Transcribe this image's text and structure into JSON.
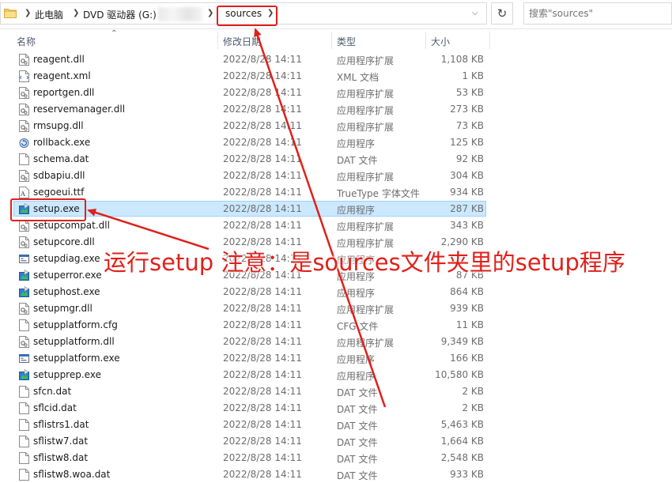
{
  "address_bar": {
    "crumbs": [
      "此电脑",
      "DVD 驱动器 (G:)",
      "sources"
    ],
    "refresh_icon": "refresh-icon",
    "dropdown_icon": "chevron-down-icon"
  },
  "search": {
    "placeholder": "搜索\"sources\""
  },
  "columns": {
    "name": "名称",
    "date": "修改日期",
    "type": "类型",
    "size": "大小"
  },
  "files": [
    {
      "name": "reagent.dll",
      "date": "2022/8/28 14:11",
      "type": "应用程序扩展",
      "size": "1,108 KB",
      "icon": "dll"
    },
    {
      "name": "reagent.xml",
      "date": "2022/8/28 14:11",
      "type": "XML 文档",
      "size": "1 KB",
      "icon": "xml"
    },
    {
      "name": "reportgen.dll",
      "date": "2022/8/28 14:11",
      "type": "应用程序扩展",
      "size": "53 KB",
      "icon": "dll"
    },
    {
      "name": "reservemanager.dll",
      "date": "2022/8/28 14:11",
      "type": "应用程序扩展",
      "size": "273 KB",
      "icon": "dll"
    },
    {
      "name": "rmsupg.dll",
      "date": "2022/8/28 14:11",
      "type": "应用程序扩展",
      "size": "73 KB",
      "icon": "dll"
    },
    {
      "name": "rollback.exe",
      "date": "2022/8/28 14:11",
      "type": "应用程序",
      "size": "125 KB",
      "icon": "exe-rollback"
    },
    {
      "name": "schema.dat",
      "date": "2022/8/28 14:11",
      "type": "DAT 文件",
      "size": "92 KB",
      "icon": "file"
    },
    {
      "name": "sdbapiu.dll",
      "date": "2022/8/28 14:11",
      "type": "应用程序扩展",
      "size": "304 KB",
      "icon": "dll"
    },
    {
      "name": "segoeui.ttf",
      "date": "2022/8/28 14:11",
      "type": "TrueType 字体文件",
      "size": "934 KB",
      "icon": "font"
    },
    {
      "name": "setup.exe",
      "date": "2022/8/28 14:11",
      "type": "应用程序",
      "size": "287 KB",
      "icon": "exe-setup",
      "selected": true
    },
    {
      "name": "setupcompat.dll",
      "date": "2022/8/28 14:11",
      "type": "应用程序扩展",
      "size": "343 KB",
      "icon": "dll"
    },
    {
      "name": "setupcore.dll",
      "date": "2022/8/28 14:11",
      "type": "应用程序扩展",
      "size": "2,290 KB",
      "icon": "dll"
    },
    {
      "name": "setupdiag.exe",
      "date": "2022/8/28 14:11",
      "type": "应用程序",
      "size": "",
      "icon": "exe-window"
    },
    {
      "name": "setuperror.exe",
      "date": "2022/8/28 14:11",
      "type": "应用程序",
      "size": "87 KB",
      "icon": "exe-setup"
    },
    {
      "name": "setuphost.exe",
      "date": "2022/8/28 14:11",
      "type": "应用程序",
      "size": "864 KB",
      "icon": "exe-setup"
    },
    {
      "name": "setupmgr.dll",
      "date": "2022/8/28 14:11",
      "type": "应用程序扩展",
      "size": "939 KB",
      "icon": "dll"
    },
    {
      "name": "setupplatform.cfg",
      "date": "2022/8/28 14:11",
      "type": "CFG 文件",
      "size": "11 KB",
      "icon": "file"
    },
    {
      "name": "setupplatform.dll",
      "date": "2022/8/28 14:11",
      "type": "应用程序扩展",
      "size": "9,349 KB",
      "icon": "dll"
    },
    {
      "name": "setupplatform.exe",
      "date": "2022/8/28 14:11",
      "type": "应用程序",
      "size": "166 KB",
      "icon": "exe-window"
    },
    {
      "name": "setupprep.exe",
      "date": "2022/8/28 14:11",
      "type": "应用程序",
      "size": "10,580 KB",
      "icon": "exe-setup"
    },
    {
      "name": "sfcn.dat",
      "date": "2022/8/28 14:11",
      "type": "DAT 文件",
      "size": "2 KB",
      "icon": "file"
    },
    {
      "name": "sflcid.dat",
      "date": "2022/8/28 14:11",
      "type": "DAT 文件",
      "size": "2 KB",
      "icon": "file"
    },
    {
      "name": "sflistrs1.dat",
      "date": "2022/8/28 14:11",
      "type": "DAT 文件",
      "size": "5,463 KB",
      "icon": "file"
    },
    {
      "name": "sflistw7.dat",
      "date": "2022/8/28 14:11",
      "type": "DAT 文件",
      "size": "1,664 KB",
      "icon": "file"
    },
    {
      "name": "sflistw8.dat",
      "date": "2022/8/28 14:11",
      "type": "DAT 文件",
      "size": "2,548 KB",
      "icon": "file"
    },
    {
      "name": "sflistw8.woa.dat",
      "date": "2022/8/28 14:11",
      "type": "DAT 文件",
      "size": "933 KB",
      "icon": "file"
    }
  ],
  "annotation": {
    "text": "运行setup 注意：是sources文件夹里的setup程序",
    "color": "#e0201a"
  }
}
